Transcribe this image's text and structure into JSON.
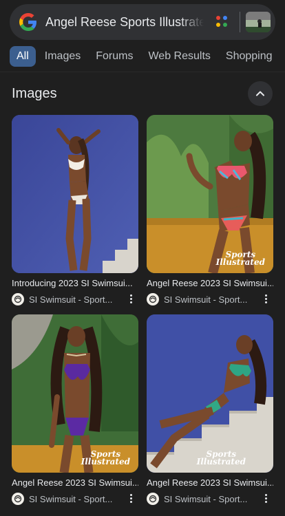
{
  "search": {
    "query": "Angel Reese Sports Illustrated"
  },
  "tabs": [
    {
      "label": "All"
    },
    {
      "label": "Images"
    },
    {
      "label": "Forums"
    },
    {
      "label": "Web Results"
    },
    {
      "label": "Shopping"
    }
  ],
  "section": {
    "title": "Images"
  },
  "results": [
    {
      "caption": "Introducing 2023 SI Swimsui...",
      "source": "SI Swimsuit - Sport..."
    },
    {
      "caption": "Angel Reese 2023 SI Swimsui...",
      "source": "SI Swimsuit - Sport...",
      "brand_line1": "Sports",
      "brand_line2": "Illustrated"
    },
    {
      "caption": "Angel Reese 2023 SI Swimsui...",
      "source": "SI Swimsuit - Sport...",
      "brand_line1": "Sports",
      "brand_line2": "Illustrated"
    },
    {
      "caption": "Angel Reese 2023 SI Swimsui...",
      "source": "SI Swimsuit - Sport...",
      "brand_line1": "Sports",
      "brand_line2": "Illustrated"
    }
  ],
  "colors": {
    "background": "#1f1f1f",
    "searchbar": "#303134",
    "active_tab": "#3c5f8f",
    "google_blue": "#4285f4",
    "google_red": "#ea4335",
    "google_yellow": "#fbbc05",
    "google_green": "#34a853"
  },
  "icons": {
    "logo": "google-g-icon",
    "lens": "google-lens-dots-icon",
    "collapse": "chevron-up-icon",
    "more": "more-vert-icon",
    "source": "si-swimsuit-favicon"
  }
}
